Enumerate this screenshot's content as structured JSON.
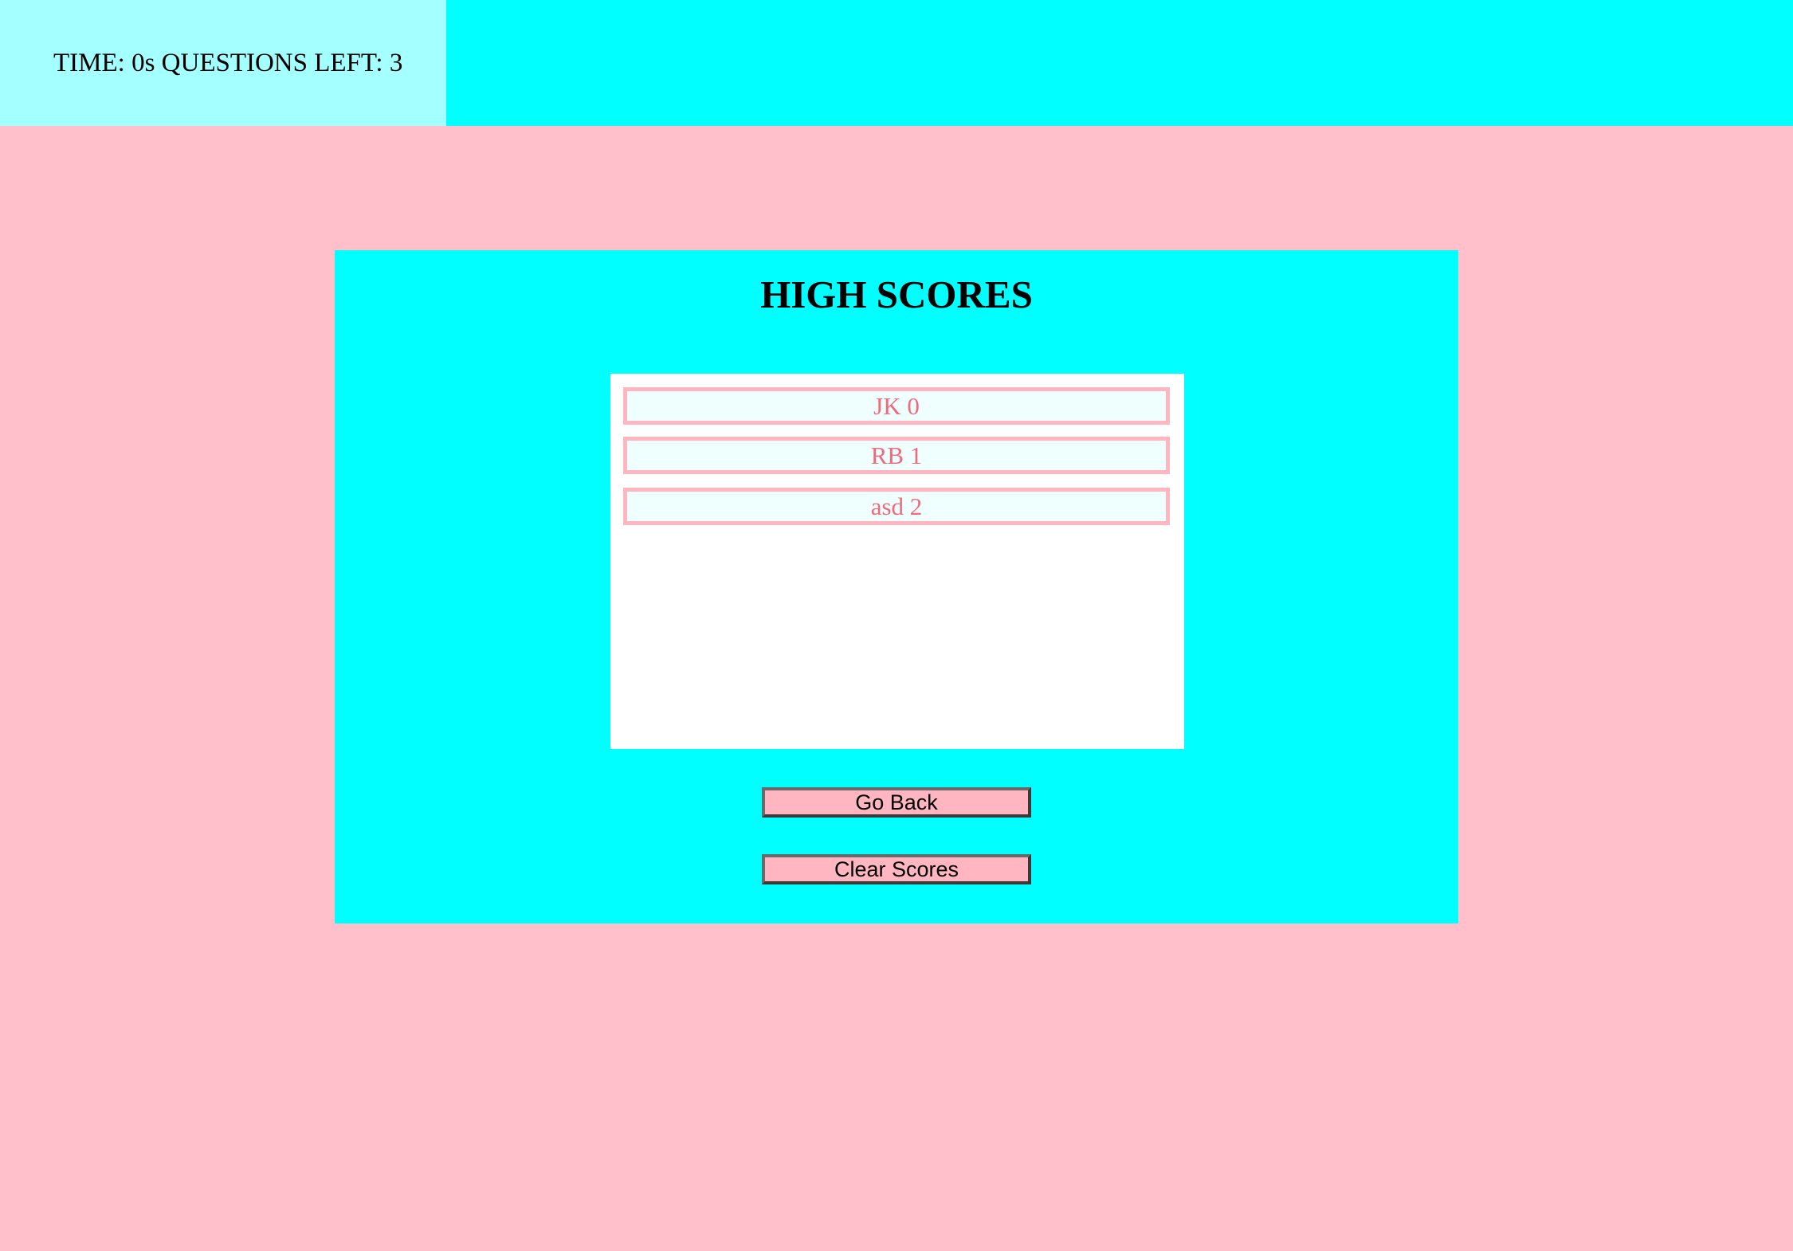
{
  "status": {
    "text": "TIME: 0s QUESTIONS LEFT: 3"
  },
  "highscores": {
    "title": "HIGH SCORES",
    "items": [
      "JK 0",
      "RB 1",
      "asd 2"
    ]
  },
  "buttons": {
    "go_back": "Go Back",
    "clear_scores": "Clear Scores"
  },
  "colors": {
    "page_background": "#ffc0cb",
    "header_background": "#00ffff",
    "status_background": "#a4ffff",
    "panel_background": "#00ffff",
    "score_text": "#ef6a7b",
    "score_item_border": "#ffb6c1",
    "button_background": "#ffb6c1"
  }
}
